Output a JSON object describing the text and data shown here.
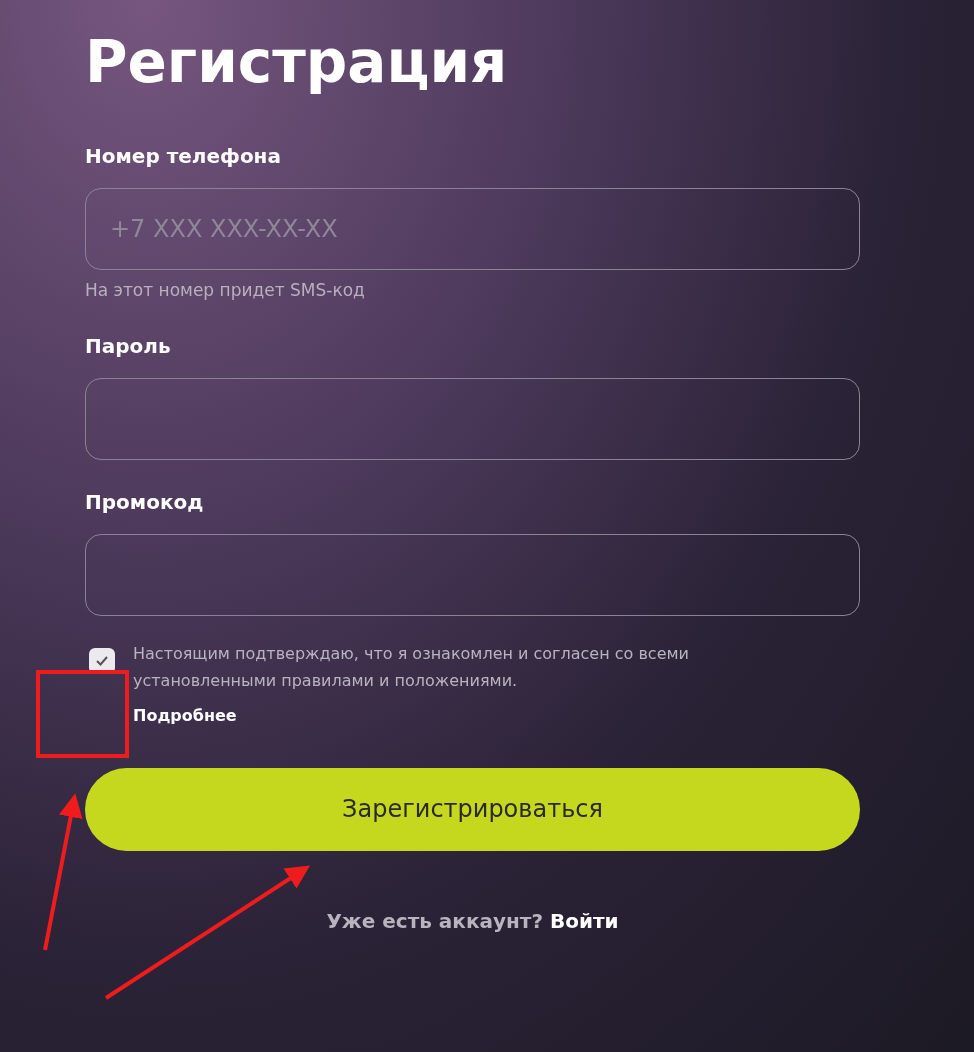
{
  "title": "Регистрация",
  "fields": [
    {
      "label": "Номер телефона",
      "placeholder": "+7 XXX XXX-XX-XX",
      "hint": "На этот номер придет SMS-код"
    },
    {
      "label": "Пароль"
    },
    {
      "label": "Промокод"
    }
  ],
  "consent": {
    "checked": true,
    "text": "Настоящим подтверждаю, что я ознакомлен и согласен со всеми установленными правилами и положениями.",
    "link": "Подробнее"
  },
  "submit_button": "Зарегистрироваться",
  "footer": {
    "question": "Уже есть аккаунт?",
    "link": "Войти"
  }
}
